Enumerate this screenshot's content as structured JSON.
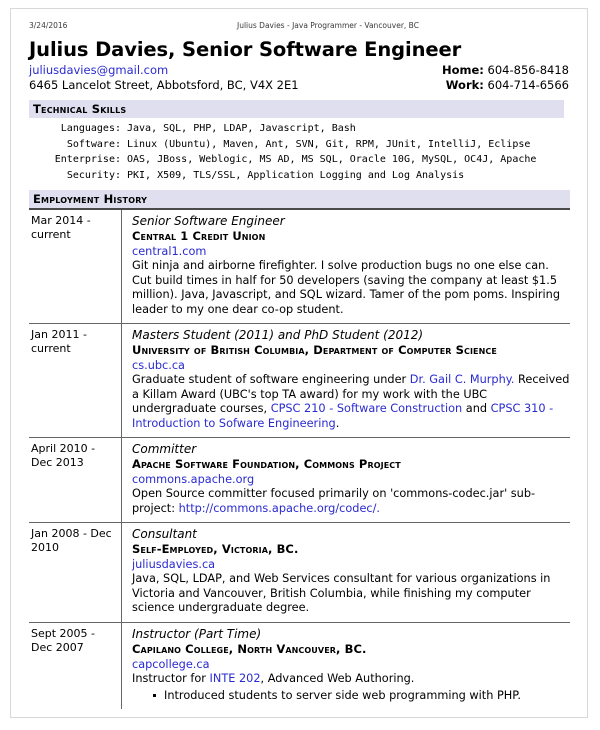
{
  "print_header": {
    "date": "3/24/2016",
    "title": "Julius Davies - Java Programmer - Vancouver, BC"
  },
  "colors": {
    "link": "#2a2ad0",
    "section_band": "#dfdff0",
    "rule": "#666666"
  },
  "header": {
    "name_line": "Julius Davies, Senior Software Engineer",
    "email": "juliusdavies@gmail.com",
    "address": "6465 Lancelot Street, Abbotsford, BC, V4X 2E1",
    "home_label": "Home:",
    "home_value": "604-856-8418",
    "work_label": "Work:",
    "work_value": "604-714-6566"
  },
  "sections": {
    "technical_skills": {
      "heading": "Technical Skills",
      "rows": [
        {
          "label": "Languages:",
          "value": "Java, SQL, PHP, LDAP, Javascript, Bash"
        },
        {
          "label": "Software:",
          "value": "Linux (Ubuntu), Maven, Ant, SVN, Git, RPM, JUnit, IntelliJ, Eclipse"
        },
        {
          "label": "Enterprise:",
          "value": "OAS, JBoss, Weblogic, MS AD, MS SQL, Oracle 10G, MySQL, OC4J, Apache"
        },
        {
          "label": "Security:",
          "value": "PKI, X509, TLS/SSL, Application Logging and Log Analysis"
        }
      ]
    },
    "employment_history": {
      "heading": "Employment History",
      "jobs": [
        {
          "when": "Mar 2014 - current",
          "title": "Senior Software Engineer",
          "org": "Central 1 Credit Union",
          "link": "central1.com",
          "desc_parts": [
            {
              "text": "Git ninja and airborne firefighter. I solve production bugs no one else can. Cut build times in half for 50 developers (saving the company at least $1.5 million). Java, Javascript, and SQL wizard. Tamer of the pom poms. Inspiring leader to my one dear co-op student.",
              "link": false
            }
          ],
          "bullets": []
        },
        {
          "when": "Jan 2011 - current",
          "title": "Masters Student (2011) and PhD Student (2012)",
          "org": "University of British Columbia, Department of Computer Science",
          "link": "cs.ubc.ca",
          "desc_parts": [
            {
              "text": "Graduate student of software engineering under ",
              "link": false
            },
            {
              "text": "Dr. Gail C. Murphy.",
              "link": true
            },
            {
              "text": " Received a Killam Award (UBC's top TA award) for my work with the UBC undergraduate courses, ",
              "link": false
            },
            {
              "text": "CPSC 210 - Software Construction",
              "link": true
            },
            {
              "text": " and ",
              "link": false
            },
            {
              "text": "CPSC 310 - Introduction to Sofware Engineering",
              "link": true
            },
            {
              "text": ".",
              "link": false
            }
          ],
          "bullets": []
        },
        {
          "when": "April 2010 - Dec 2013",
          "title": "Committer",
          "org": "Apache Software Foundation, Commons Project",
          "link": "commons.apache.org",
          "desc_parts": [
            {
              "text": "Open Source committer focused primarily on 'commons-codec.jar' sub-project: ",
              "link": false
            },
            {
              "text": "http://commons.apache.org/codec/.",
              "link": true
            }
          ],
          "bullets": []
        },
        {
          "when": "Jan 2008 - Dec 2010",
          "title": "Consultant",
          "org": "Self-Employed, Victoria, BC.",
          "link": "juliusdavies.ca",
          "desc_parts": [
            {
              "text": "Java, SQL, LDAP, and Web Services consultant for various organizations in Victoria and Vancouver, British Columbia, while finishing my computer science undergraduate degree.",
              "link": false
            }
          ],
          "bullets": []
        },
        {
          "when": "Sept 2005 - Dec 2007",
          "title": "Instructor (Part Time)",
          "org": "Capilano College, North Vancouver, BC.",
          "link": "capcollege.ca",
          "desc_parts": [
            {
              "text": "Instructor for ",
              "link": false
            },
            {
              "text": "INTE 202",
              "link": true
            },
            {
              "text": ", Advanced Web Authoring.",
              "link": false
            }
          ],
          "bullets": [
            "Introduced students to server side web programming with PHP."
          ]
        }
      ]
    }
  }
}
